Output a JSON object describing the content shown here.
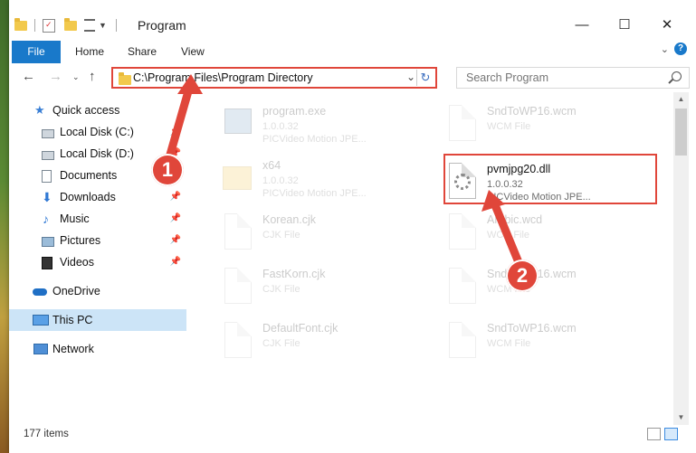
{
  "window": {
    "title": "Program",
    "minimize": "—",
    "maximize": "☐",
    "close": "✕"
  },
  "ribbon": {
    "file": "File",
    "tabs": [
      "Home",
      "Share",
      "View"
    ],
    "help": "?"
  },
  "address": {
    "path": "C:\\Program Files\\Program Directory",
    "search_placeholder": "Search Program"
  },
  "nav": {
    "items": [
      {
        "label": "Quick access",
        "icon": "star-icon",
        "pinned": false
      },
      {
        "label": "Local Disk (C:)",
        "icon": "drive-icon",
        "pinned": true
      },
      {
        "label": "Local Disk (D:)",
        "icon": "drive-icon",
        "pinned": true
      },
      {
        "label": "Documents",
        "icon": "documents-icon",
        "pinned": true
      },
      {
        "label": "Downloads",
        "icon": "downloads-icon",
        "pinned": true
      },
      {
        "label": "Music",
        "icon": "music-icon",
        "pinned": true
      },
      {
        "label": "Pictures",
        "icon": "pictures-icon",
        "pinned": true
      },
      {
        "label": "Videos",
        "icon": "videos-icon",
        "pinned": true
      },
      {
        "label": "OneDrive",
        "icon": "cloud-icon",
        "pinned": false
      },
      {
        "label": "This PC",
        "icon": "computer-icon",
        "pinned": false
      },
      {
        "label": "Network",
        "icon": "network-icon",
        "pinned": false
      }
    ]
  },
  "files": [
    {
      "name": "program.exe",
      "line2": "1.0.0.32",
      "line3": "PICVideo Motion JPE..."
    },
    {
      "name": "SndToWP16.wcm",
      "line2": "WCM File",
      "line3": ""
    },
    {
      "name": "x64",
      "line2": "1.0.0.32",
      "line3": "PICVideo Motion JPE..."
    },
    {
      "name": "pvmjpg20.dll",
      "line2": "1.0.0.32",
      "line3": "PICVideo Motion JPE..."
    },
    {
      "name": "Korean.cjk",
      "line2": "CJK File",
      "line3": ""
    },
    {
      "name": "Arabic.wcd",
      "line2": "WCD File",
      "line3": ""
    },
    {
      "name": "FastKorn.cjk",
      "line2": "CJK File",
      "line3": ""
    },
    {
      "name": "SndToWP16.wcm",
      "line2": "WCM File",
      "line3": ""
    },
    {
      "name": "DefaultFont.cjk",
      "line2": "CJK File",
      "line3": ""
    },
    {
      "name": "SndToWP16.wcm",
      "line2": "WCM File",
      "line3": ""
    }
  ],
  "status": {
    "count": "177 items"
  },
  "callouts": [
    "1",
    "2"
  ],
  "colors": {
    "accent": "#1979ca",
    "highlight": "#e0463a",
    "selected": "#cce4f7"
  }
}
